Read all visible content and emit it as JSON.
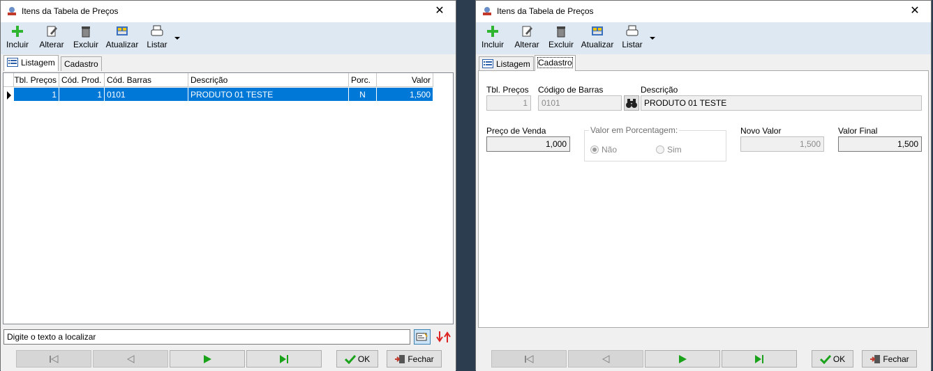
{
  "window_left": {
    "title": "Itens da Tabela de Preços",
    "toolbar": {
      "incluir": "Incluir",
      "alterar": "Alterar",
      "excluir": "Excluir",
      "atualizar": "Atualizar",
      "listar": "Listar"
    },
    "tabs": [
      "Listagem",
      "Cadastro"
    ],
    "active_tab": "Listagem",
    "grid": {
      "columns": [
        "Tbl. Preços",
        "Cód. Prod.",
        "Cód. Barras",
        "Descrição",
        "Porc.",
        "Valor"
      ],
      "rows": [
        {
          "tbl_precos": "1",
          "cod_prod": "1",
          "cod_barras": "0101",
          "descricao": "PRODUTO 01 TESTE",
          "porc": "N",
          "valor": "1,500"
        }
      ]
    },
    "search": {
      "value": "Digite o texto a localizar"
    },
    "buttons": {
      "ok": "OK",
      "fechar": "Fechar"
    }
  },
  "window_right": {
    "title": "Itens da Tabela de Preços",
    "toolbar": {
      "incluir": "Incluir",
      "alterar": "Alterar",
      "excluir": "Excluir",
      "atualizar": "Atualizar",
      "listar": "Listar"
    },
    "tabs": [
      "Listagem",
      "Cadastro"
    ],
    "active_tab": "Cadastro",
    "form": {
      "tbl_precos_label": "Tbl. Preços",
      "tbl_precos_value": "1",
      "codigo_barras_label": "Código de Barras",
      "codigo_barras_value": "0101",
      "descricao_label": "Descrição",
      "descricao_value": "PRODUTO 01 TESTE",
      "preco_venda_label": "Preço de Venda",
      "preco_venda_value": "1,000",
      "valor_porcentagem_label": "Valor em Porcentagem:",
      "radio_nao": "Não",
      "radio_sim": "Sim",
      "radio_selected": "Não",
      "novo_valor_label": "Novo Valor",
      "novo_valor_value": "1,500",
      "valor_final_label": "Valor Final",
      "valor_final_value": "1,500"
    },
    "buttons": {
      "ok": "OK",
      "fechar": "Fechar"
    }
  },
  "colors": {
    "toolbar_bg": "#dde8f3",
    "selection": "#0078d7",
    "nav_green": "#1aa31a"
  }
}
